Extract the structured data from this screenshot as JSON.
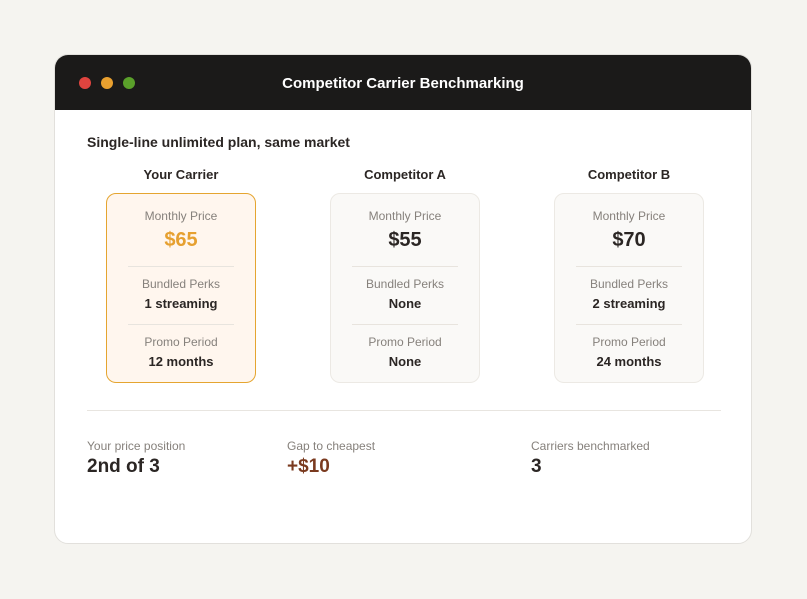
{
  "window": {
    "title": "Competitor Carrier Benchmarking"
  },
  "subtitle": "Single-line unlimited plan, same market",
  "labels": {
    "price": "Monthly Price",
    "perks": "Bundled Perks",
    "promo": "Promo Period"
  },
  "carriers": [
    {
      "name": "Your Carrier",
      "price": "$65",
      "perks": "1 streaming",
      "promo": "12 months"
    },
    {
      "name": "Competitor A",
      "price": "$55",
      "perks": "None",
      "promo": "None"
    },
    {
      "name": "Competitor B",
      "price": "$70",
      "perks": "2 streaming",
      "promo": "24 months"
    }
  ],
  "summary": {
    "position_label": "Your price position",
    "position_value": "2nd of 3",
    "gap_label": "Gap to cheapest",
    "gap_value": "+$10",
    "count_label": "Carriers benchmarked",
    "count_value": "3"
  },
  "colors": {
    "accent": "#e6a030",
    "titlebar": "#1b1a19",
    "gap": "#7a3a1f"
  }
}
